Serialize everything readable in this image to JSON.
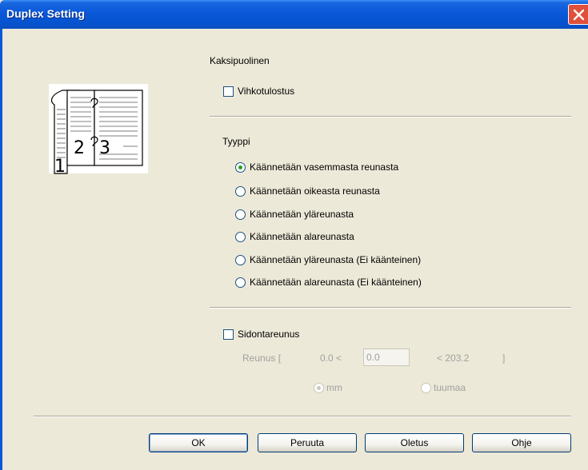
{
  "window": {
    "title": "Duplex Setting"
  },
  "duplex_group": {
    "label": "Kaksipuolinen",
    "booklet_label": "Vihkotulostus",
    "booklet_checked": false
  },
  "type_group": {
    "label": "Tyyppi",
    "options": [
      {
        "label": "Käännetään vasemmasta reunasta",
        "selected": true
      },
      {
        "label": "Käännetään oikeasta reunasta",
        "selected": false
      },
      {
        "label": "Käännetään yläreunasta",
        "selected": false
      },
      {
        "label": "Käännetään alareunasta",
        "selected": false
      },
      {
        "label": "Käännetään yläreunasta (Ei käänteinen)",
        "selected": false
      },
      {
        "label": "Käännetään alareunasta (Ei käänteinen)",
        "selected": false
      }
    ]
  },
  "binding_offset": {
    "label": "Sidontareunus",
    "checked": false,
    "range_label": "Reunus [",
    "min": "0.0 <",
    "value": "0.0",
    "max": "<   203.2",
    "close_bracket": "]",
    "unit_mm": "mm",
    "unit_inch": "tuumaa",
    "unit_selected": "mm"
  },
  "preview": {
    "pages": [
      "1",
      "2",
      "3"
    ]
  },
  "buttons": {
    "ok": "OK",
    "cancel": "Peruuta",
    "default": "Oletus",
    "help": "Ohje"
  }
}
